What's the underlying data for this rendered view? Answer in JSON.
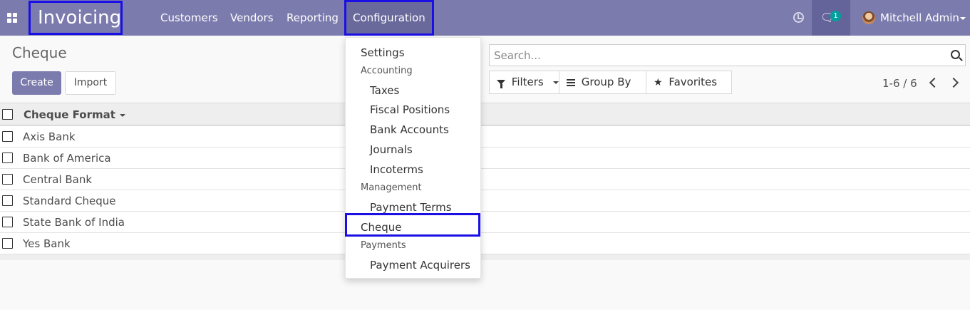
{
  "navbar": {
    "app_title": "Invoicing",
    "menu": [
      "Customers",
      "Vendors",
      "Reporting",
      "Configuration"
    ],
    "active_menu": "Configuration",
    "chat_badge": "1",
    "user_name": "Mitchell Admin",
    "color": "#7c7bad",
    "icons": [
      "apps-grid-icon",
      "clock-icon",
      "chat-icon",
      "avatar",
      "chevron-down-icon"
    ]
  },
  "control_panel": {
    "title": "Cheque",
    "create_label": "Create",
    "import_label": "Import",
    "search_placeholder": "Search...",
    "filters_label": "Filters",
    "group_by_label": "Group By",
    "favorites_label": "Favorites",
    "pager": "1-6 / 6"
  },
  "list": {
    "column": "Cheque Format",
    "rows": [
      "Axis Bank",
      "Bank of America",
      "Central Bank",
      "Standard Cheque",
      "State Bank of India",
      "Yes Bank"
    ]
  },
  "config_menu": {
    "settings": "Settings",
    "accounting_header": "Accounting",
    "accounting_items": [
      "Taxes",
      "Fiscal Positions",
      "Bank Accounts",
      "Journals",
      "Incoterms"
    ],
    "management_header": "Management",
    "payment_terms": "Payment Terms",
    "cheque": "Cheque",
    "payments_header": "Payments",
    "payment_acquirers": "Payment Acquirers"
  }
}
